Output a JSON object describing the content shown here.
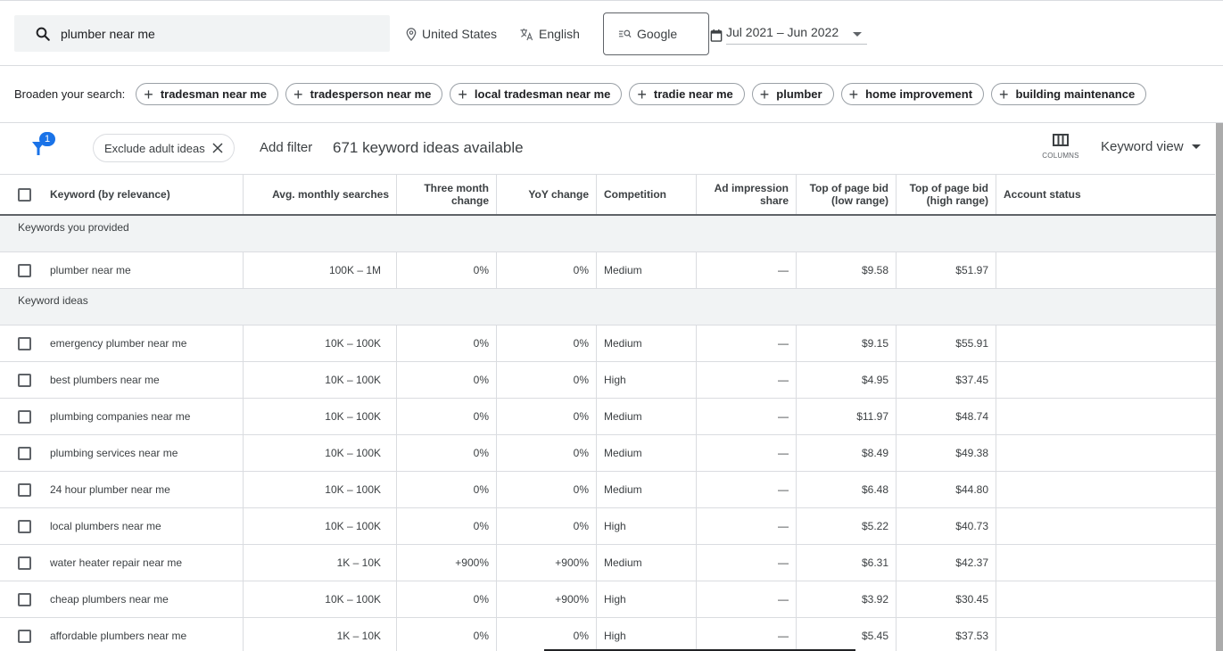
{
  "topbar": {
    "search_value": "plumber near me",
    "location": "United States",
    "language": "English",
    "network": "Google",
    "date_range": "Jul 2021 – Jun 2022"
  },
  "broaden": {
    "label": "Broaden your search:",
    "chips": [
      "tradesman near me",
      "tradesperson near me",
      "local tradesman near me",
      "tradie near me",
      "plumber",
      "home improvement",
      "building maintenance"
    ]
  },
  "filterbar": {
    "filter_badge": "1",
    "exclude_chip": "Exclude adult ideas",
    "add_filter": "Add filter",
    "count_text": "671 keyword ideas available",
    "columns_label": "COLUMNS",
    "view_label": "Keyword view"
  },
  "table": {
    "headers": {
      "keyword": "Keyword (by relevance)",
      "avg": "Avg. monthly searches",
      "three_month_1": "Three month",
      "three_month_2": "change",
      "yoy": "YoY change",
      "competition": "Competition",
      "ad_imp_1": "Ad impression",
      "ad_imp_2": "share",
      "low_1": "Top of page bid",
      "low_2": "(low range)",
      "high_1": "Top of page bid",
      "high_2": "(high range)",
      "account": "Account status"
    },
    "group_provided": "Keywords you provided",
    "provided": [
      {
        "keyword": "plumber near me",
        "avg": "100K – 1M",
        "three": "0%",
        "yoy": "0%",
        "competition": "Medium",
        "adimp": "—",
        "low": "$9.58",
        "high": "$51.97",
        "account": ""
      }
    ],
    "group_ideas": "Keyword ideas",
    "ideas": [
      {
        "keyword": "emergency plumber near me",
        "avg": "10K – 100K",
        "three": "0%",
        "yoy": "0%",
        "competition": "Medium",
        "adimp": "—",
        "low": "$9.15",
        "high": "$55.91",
        "account": ""
      },
      {
        "keyword": "best plumbers near me",
        "avg": "10K – 100K",
        "three": "0%",
        "yoy": "0%",
        "competition": "High",
        "adimp": "—",
        "low": "$4.95",
        "high": "$37.45",
        "account": ""
      },
      {
        "keyword": "plumbing companies near me",
        "avg": "10K – 100K",
        "three": "0%",
        "yoy": "0%",
        "competition": "Medium",
        "adimp": "—",
        "low": "$11.97",
        "high": "$48.74",
        "account": ""
      },
      {
        "keyword": "plumbing services near me",
        "avg": "10K – 100K",
        "three": "0%",
        "yoy": "0%",
        "competition": "Medium",
        "adimp": "—",
        "low": "$8.49",
        "high": "$49.38",
        "account": ""
      },
      {
        "keyword": "24 hour plumber near me",
        "avg": "10K – 100K",
        "three": "0%",
        "yoy": "0%",
        "competition": "Medium",
        "adimp": "—",
        "low": "$6.48",
        "high": "$44.80",
        "account": ""
      },
      {
        "keyword": "local plumbers near me",
        "avg": "10K – 100K",
        "three": "0%",
        "yoy": "0%",
        "competition": "High",
        "adimp": "—",
        "low": "$5.22",
        "high": "$40.73",
        "account": ""
      },
      {
        "keyword": "water heater repair near me",
        "avg": "1K – 10K",
        "three": "+900%",
        "yoy": "+900%",
        "competition": "Medium",
        "adimp": "—",
        "low": "$6.31",
        "high": "$42.37",
        "account": ""
      },
      {
        "keyword": "cheap plumbers near me",
        "avg": "10K – 100K",
        "three": "0%",
        "yoy": "+900%",
        "competition": "High",
        "adimp": "—",
        "low": "$3.92",
        "high": "$30.45",
        "account": ""
      },
      {
        "keyword": "affordable plumbers near me",
        "avg": "1K – 10K",
        "three": "0%",
        "yoy": "0%",
        "competition": "High",
        "adimp": "—",
        "low": "$5.45",
        "high": "$37.53",
        "account": ""
      }
    ]
  },
  "colors": {
    "accent": "#1a73e8",
    "group_bg": "#f1f3f4",
    "border": "#dadce0",
    "text": "#3c4043"
  }
}
